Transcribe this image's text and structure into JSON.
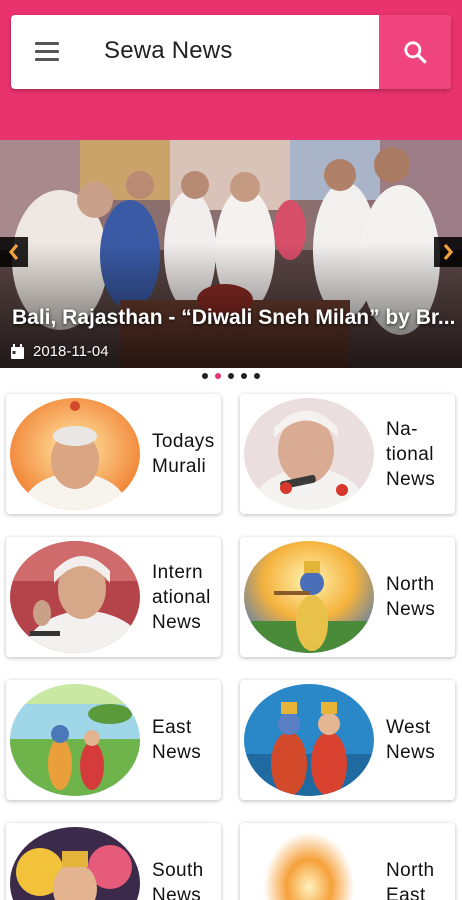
{
  "header": {
    "title": "Sewa News",
    "menu_icon": "hamburger-menu-icon",
    "search_icon": "search-icon",
    "accent_color": "#e8336e",
    "search_button_color": "#f0447f"
  },
  "slider": {
    "caption": "Bali, Rajasthan - “Diwali Sneh Milan” by Br...",
    "date": "2018-11-04",
    "date_icon": "calendar-icon",
    "prev_icon": "chevron-left-icon",
    "next_icon": "chevron-right-icon",
    "dots_count": 5,
    "active_dot": 1
  },
  "categories": [
    {
      "line1": "Todays",
      "line2": "Murali",
      "line3": ""
    },
    {
      "line1": "Na-",
      "line2": "tional",
      "line3": "News"
    },
    {
      "line1": "Intern",
      "line2": "ational",
      "line3": "News"
    },
    {
      "line1": "North",
      "line2": "News",
      "line3": ""
    },
    {
      "line1": "East",
      "line2": "News",
      "line3": ""
    },
    {
      "line1": "West",
      "line2": "News",
      "line3": ""
    },
    {
      "line1": "South",
      "line2": "News",
      "line3": ""
    },
    {
      "line1": "North",
      "line2": "East",
      "line3": ""
    }
  ]
}
